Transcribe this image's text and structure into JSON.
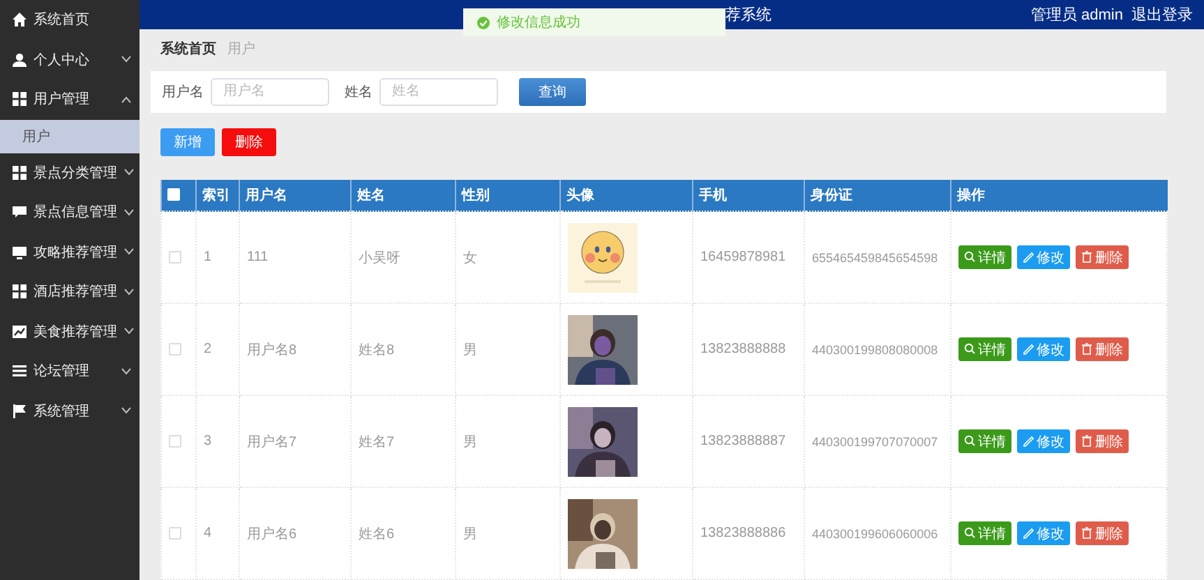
{
  "header": {
    "title": "荐系统",
    "user": "管理员 admin",
    "logout": "退出登录"
  },
  "toast": {
    "text": "修改信息成功"
  },
  "sidebar": {
    "items": [
      {
        "label": "系统首页",
        "kind": "link"
      },
      {
        "label": "个人中心",
        "kind": "menu",
        "expanded": false
      },
      {
        "label": "用户管理",
        "kind": "menu",
        "expanded": true,
        "children": [
          {
            "label": "用户",
            "selected": true
          }
        ]
      },
      {
        "label": "景点分类管理",
        "kind": "menu",
        "expanded": false
      },
      {
        "label": "景点信息管理",
        "kind": "menu",
        "expanded": false
      },
      {
        "label": "攻略推荐管理",
        "kind": "menu",
        "expanded": false
      },
      {
        "label": "酒店推荐管理",
        "kind": "menu",
        "expanded": false
      },
      {
        "label": "美食推荐管理",
        "kind": "menu",
        "expanded": false
      },
      {
        "label": "论坛管理",
        "kind": "menu",
        "expanded": false
      },
      {
        "label": "系统管理",
        "kind": "menu",
        "expanded": false
      }
    ]
  },
  "breadcrumb": [
    "系统首页",
    "用户"
  ],
  "search": {
    "fields": [
      {
        "label": "用户名",
        "placeholder": "用户名"
      },
      {
        "label": "姓名",
        "placeholder": "姓名"
      }
    ],
    "button": "查询"
  },
  "actions": [
    {
      "kind": "add",
      "label": "新增"
    },
    {
      "kind": "delete",
      "label": "删除"
    }
  ],
  "table": {
    "all_checked": false,
    "columns": [
      "索引",
      "用户名",
      "姓名",
      "性别",
      "头像",
      "手机",
      "身份证",
      "操作"
    ],
    "rows": [
      {
        "checked": false,
        "index": "1",
        "username": "111",
        "name": "小吴呀",
        "gender": "女",
        "phone": "16459878981",
        "id_card": "655465459845654598",
        "ops": [
          {
            "kind": "detail",
            "label": "详情"
          },
          {
            "kind": "edit",
            "label": "修改"
          },
          {
            "kind": "remove",
            "label": "删除"
          }
        ]
      },
      {
        "checked": false,
        "index": "2",
        "username": "用户名8",
        "name": "姓名8",
        "gender": "男",
        "phone": "13823888888",
        "id_card": "440300199808080008",
        "ops": [
          {
            "kind": "detail",
            "label": "详情"
          },
          {
            "kind": "edit",
            "label": "修改"
          },
          {
            "kind": "remove",
            "label": "删除"
          }
        ]
      },
      {
        "checked": false,
        "index": "3",
        "username": "用户名7",
        "name": "姓名7",
        "gender": "男",
        "phone": "13823888887",
        "id_card": "440300199707070007",
        "ops": [
          {
            "kind": "detail",
            "label": "详情"
          },
          {
            "kind": "edit",
            "label": "修改"
          },
          {
            "kind": "remove",
            "label": "删除"
          }
        ]
      },
      {
        "checked": false,
        "index": "4",
        "username": "用户名6",
        "name": "姓名6",
        "gender": "男",
        "phone": "13823888886",
        "id_card": "440300199606060006",
        "ops": [
          {
            "kind": "detail",
            "label": "详情"
          },
          {
            "kind": "edit",
            "label": "修改"
          },
          {
            "kind": "remove",
            "label": "删除"
          }
        ]
      }
    ]
  }
}
